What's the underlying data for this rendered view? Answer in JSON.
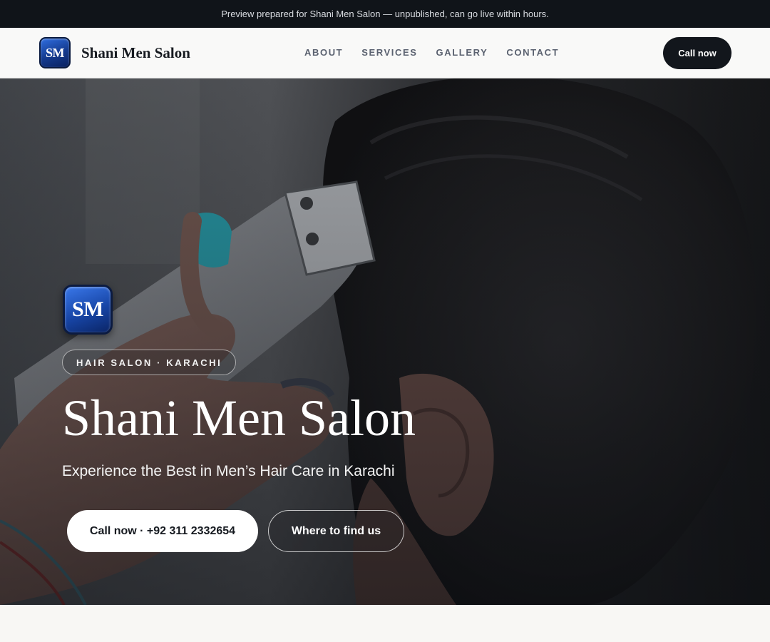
{
  "announcement": {
    "text": "Preview prepared for Shani Men Salon — unpublished, can go live within hours."
  },
  "header": {
    "logo_initials": "SM",
    "brand_name": "Shani Men Salon",
    "nav": [
      {
        "label": "ABOUT"
      },
      {
        "label": "SERVICES"
      },
      {
        "label": "GALLERY"
      },
      {
        "label": "CONTACT"
      }
    ],
    "cta_label": "Call now"
  },
  "hero": {
    "image_description_icon": "barber-haircut-photo",
    "logo_initials": "SM",
    "tag": "HAIR SALON · KARACHI",
    "title": "Shani Men Salon",
    "subtitle": "Experience the Best in Men’s Hair Care in Karachi",
    "primary_button": "Call now · +92 311 2332654",
    "secondary_button": "Where to find us"
  },
  "colors": {
    "announcement_bg": "#101419",
    "navbar_bg": "#f9f9f8",
    "cta_bg": "#12161c",
    "logo_blue": "#1745a6",
    "page_bg": "#f8f7f4"
  }
}
